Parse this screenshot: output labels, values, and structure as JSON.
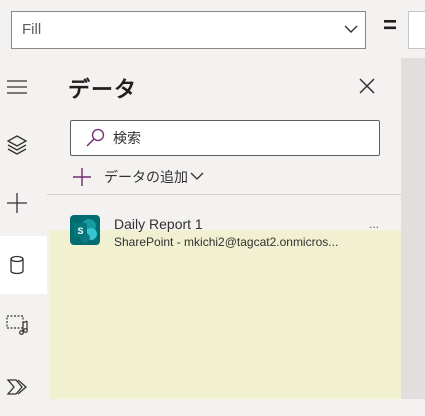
{
  "property_bar": {
    "selected_property": "Fill",
    "equals": "="
  },
  "rail": {
    "items": [
      {
        "icon": "hamburger-menu-icon",
        "active": false
      },
      {
        "icon": "layers-icon",
        "active": false
      },
      {
        "icon": "plus-icon",
        "active": false
      },
      {
        "icon": "database-icon",
        "active": true
      },
      {
        "icon": "media-icon",
        "active": false
      },
      {
        "icon": "power-automate-icon",
        "active": false
      }
    ]
  },
  "data_panel": {
    "title": "データ",
    "search": {
      "placeholder": "検索",
      "value": ""
    },
    "add_data_label": "データの追加",
    "sources": [
      {
        "name": "Daily Report 1",
        "detail": "SharePoint - mkichi2@tagcat2.onmicros...",
        "icon": "sharepoint-icon",
        "more": "..."
      }
    ]
  },
  "colors": {
    "accent": "#742774",
    "sharepoint": "#036c70",
    "selection_highlight": "#f1f1d1",
    "panel_background": "#f3f2f1"
  }
}
